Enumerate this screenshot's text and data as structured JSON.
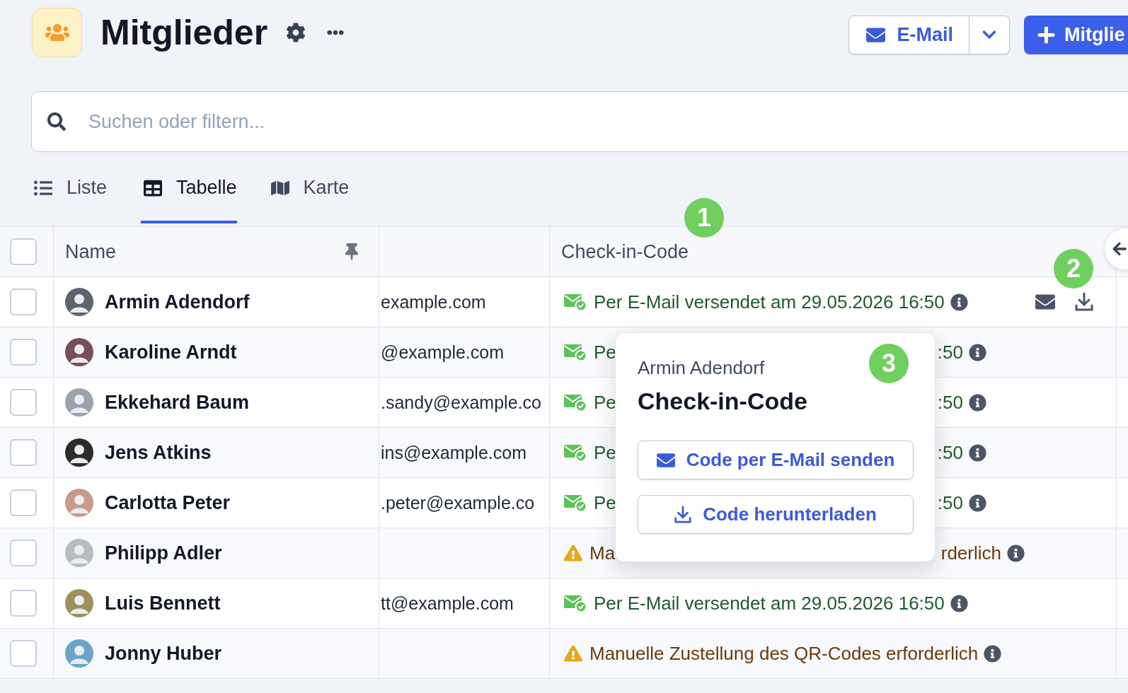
{
  "header": {
    "title": "Mitglieder",
    "email_button": "E-Mail",
    "add_button": "Mitglie"
  },
  "search": {
    "placeholder": "Suchen oder filtern..."
  },
  "view_tabs": [
    {
      "label": "Liste",
      "kind": "list",
      "selected": false
    },
    {
      "label": "Tabelle",
      "kind": "table",
      "selected": true
    },
    {
      "label": "Karte",
      "kind": "map",
      "selected": false
    }
  ],
  "table": {
    "all_checked": false,
    "columns": {
      "name": "Name",
      "name_pinned": true,
      "check_in": "Check-in-Code"
    },
    "rows": [
      {
        "name": "Armin Adendorf",
        "email": "example.com",
        "checked": false,
        "hovered": true,
        "status": {
          "kind": "sent",
          "parts": [
            "Per E-Mail versendet am 29.05.2026 16:50"
          ]
        }
      },
      {
        "name": "Karoline Arndt",
        "email": "@example.com",
        "checked": false,
        "hovered": false,
        "status": {
          "kind": "sent",
          "parts": [
            "Pe",
            ":50"
          ]
        }
      },
      {
        "name": "Ekkehard Baum",
        "email": ".sandy@example.co",
        "checked": false,
        "hovered": false,
        "status": {
          "kind": "sent",
          "parts": [
            "Pe",
            ":50"
          ]
        }
      },
      {
        "name": "Jens Atkins",
        "email": "ins@example.com",
        "checked": false,
        "hovered": false,
        "status": {
          "kind": "sent",
          "parts": [
            "Pe",
            ":50"
          ]
        }
      },
      {
        "name": "Carlotta Peter",
        "email": ".peter@example.co",
        "checked": false,
        "hovered": false,
        "status": {
          "kind": "sent",
          "parts": [
            "Pe",
            ":50"
          ]
        }
      },
      {
        "name": "Philipp Adler",
        "checked": false,
        "hovered": false,
        "status": {
          "kind": "manual",
          "parts": [
            "Ma",
            "rderlich"
          ]
        }
      },
      {
        "name": "Luis Bennett",
        "email": "tt@example.com",
        "checked": false,
        "hovered": false,
        "status": {
          "kind": "sent",
          "parts": [
            "Per E-Mail versendet am 29.05.2026 16:50"
          ]
        }
      },
      {
        "name": "Jonny Huber",
        "checked": false,
        "hovered": false,
        "status": {
          "kind": "manual",
          "parts": [
            "Manuelle Zustellung des QR-Codes erforderlich"
          ]
        }
      }
    ]
  },
  "popover": {
    "subtitle": "Armin Adendorf",
    "title": "Check-in-Code",
    "actions": [
      {
        "kind": "email",
        "label": "Code per E-Mail senden"
      },
      {
        "kind": "download",
        "label": "Code herunterladen"
      }
    ]
  },
  "step_markers": [
    {
      "label": "1"
    },
    {
      "label": "2"
    },
    {
      "label": "3"
    }
  ]
}
